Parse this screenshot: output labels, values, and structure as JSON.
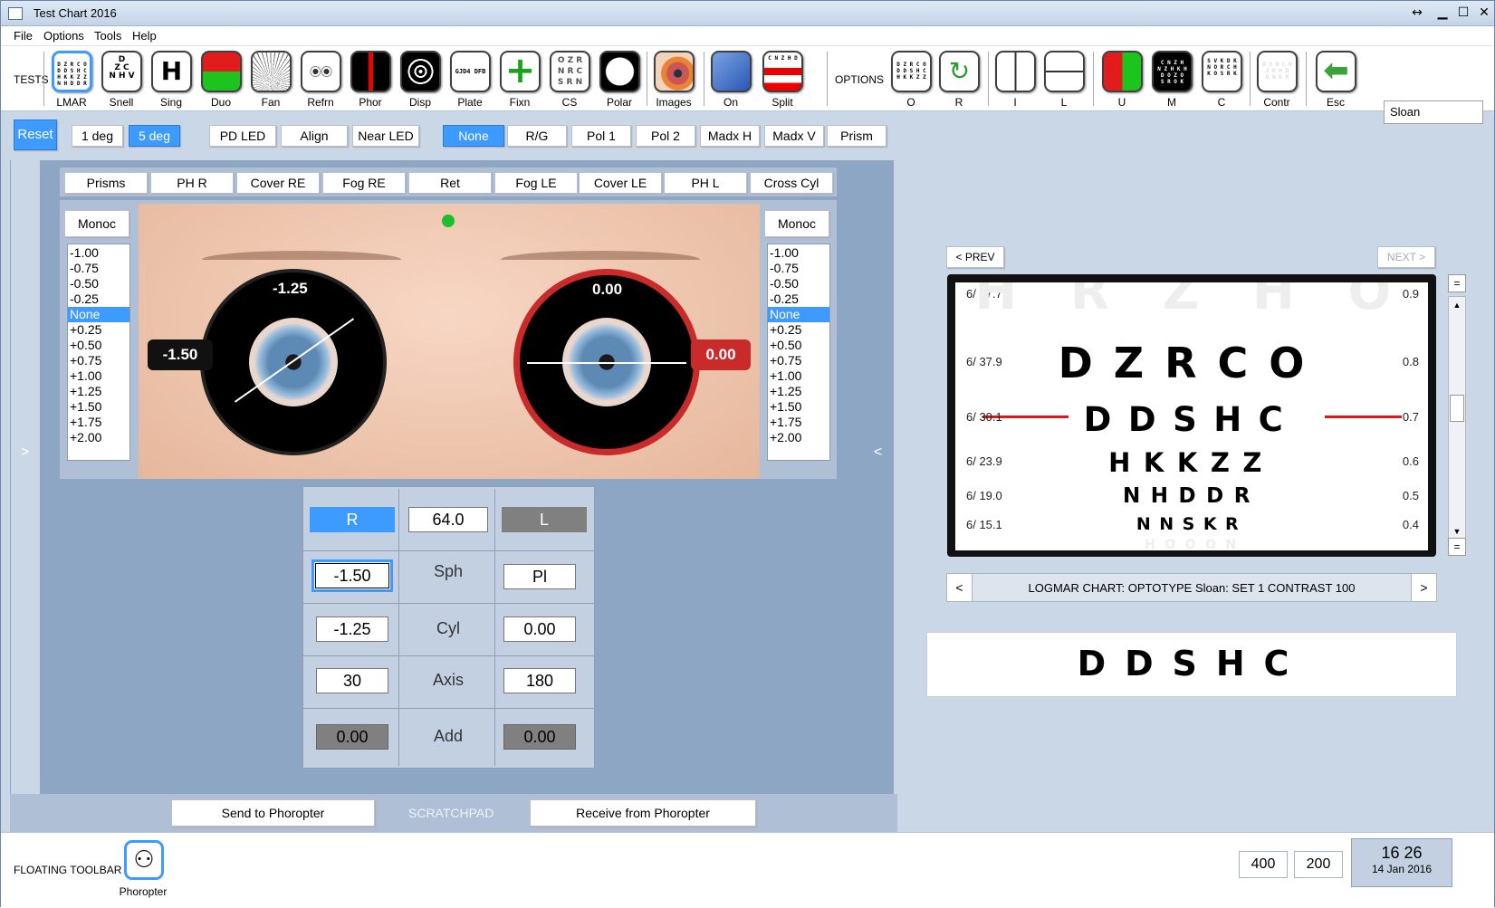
{
  "window": {
    "title": "Test Chart 2016",
    "restore": "↔",
    "minimize": "▁",
    "maximize": "☐",
    "close": "✕"
  },
  "menu": [
    "File",
    "Options",
    "Tools",
    "Help"
  ],
  "toolbar": {
    "tests_label": "TESTS",
    "options_label": "OPTIONS",
    "tests": [
      {
        "label": "LMAR",
        "icon": "logmar-chart-icon"
      },
      {
        "label": "Snell",
        "icon": "snellen-chart-icon"
      },
      {
        "label": "Sing",
        "icon": "single-letter-icon"
      },
      {
        "label": "Duo",
        "icon": "duochrome-icon"
      },
      {
        "label": "Fan",
        "icon": "fan-chart-icon"
      },
      {
        "label": "Refrn",
        "icon": "refraction-icon"
      },
      {
        "label": "Phor",
        "icon": "phoria-icon"
      },
      {
        "label": "Disp",
        "icon": "disparity-icon"
      },
      {
        "label": "Plate",
        "icon": "plate-icon"
      },
      {
        "label": "Fixn",
        "icon": "fixation-cross-icon"
      },
      {
        "label": "CS",
        "icon": "contrast-sensitivity-icon"
      },
      {
        "label": "Polar",
        "icon": "polar-icon"
      },
      {
        "label": "Images",
        "icon": "eye-image-icon"
      },
      {
        "label": "On",
        "icon": "screen-on-icon"
      },
      {
        "label": "Split",
        "icon": "split-chart-icon"
      }
    ],
    "options": [
      {
        "label": "O",
        "icon": "optotype-chart-icon"
      },
      {
        "label": "R",
        "icon": "rotate-icon"
      },
      {
        "label": "I",
        "icon": "vertical-line-icon"
      },
      {
        "label": "L",
        "icon": "horizontal-line-icon"
      },
      {
        "label": "U",
        "icon": "red-green-chart-icon"
      },
      {
        "label": "M",
        "icon": "mirror-chart-icon"
      },
      {
        "label": "C",
        "icon": "crowded-chart-icon"
      },
      {
        "label": "Contr",
        "icon": "contrast-icon"
      },
      {
        "label": "Esc",
        "icon": "back-arrow-icon"
      }
    ],
    "optotype_value": "Sloan",
    "tool_text": {
      "snell": "D\nZ C\nN H V",
      "sing": "H",
      "plate": "GJD4 DFB",
      "cs": "O Z R\nN R C\nS R N",
      "split": "C N Z H D"
    }
  },
  "controls": {
    "reset": "Reset",
    "deg1": "1 deg",
    "deg5": "5 deg",
    "pd_led": "PD LED",
    "align": "Align",
    "near_led": "Near LED",
    "filters": [
      "None",
      "R/G",
      "Pol 1",
      "Pol 2",
      "Madx H",
      "Madx V",
      "Prism"
    ]
  },
  "phoropter": {
    "tabs": [
      "Prisms",
      "PH R",
      "Cover RE",
      "Fog RE",
      "Ret",
      "Fog LE",
      "Cover LE",
      "PH L",
      "Cross Cyl"
    ],
    "monoc_left": "Monoc",
    "monoc_right": "Monoc",
    "steps": [
      "-1.00",
      "-0.75",
      "-0.50",
      "-0.25",
      "None",
      "+0.25",
      "+0.50",
      "+0.75",
      "+1.00",
      "+1.25",
      "+1.50",
      "+1.75",
      "+2.00"
    ],
    "selected_step": "None",
    "right_ring_top": "-1.25",
    "right_tag": "-1.50",
    "left_ring_top": "0.00",
    "left_tag": "0.00",
    "left_arrow": ">",
    "right_arrow": "<"
  },
  "rx": {
    "r_label": "R",
    "l_label": "L",
    "pd": "64.0",
    "rows": [
      {
        "name": "Sph",
        "r": "-1.50",
        "l": "Pl"
      },
      {
        "name": "Cyl",
        "r": "-1.25",
        "l": "0.00"
      },
      {
        "name": "Axis",
        "r": "30",
        "l": "180"
      },
      {
        "name": "Add",
        "r": "0.00",
        "l": "0.00"
      }
    ]
  },
  "scratchpad": {
    "send": "Send to  Phoropter",
    "label": "SCRATCHPAD",
    "receive": "Receive from  Phoropter"
  },
  "chart": {
    "prev": "< PREV",
    "next": "NEXT >",
    "rows": [
      {
        "snellen": "6/ 47.7",
        "logmar": "0.9",
        "letters": "H R Z H O"
      },
      {
        "snellen": "6/ 37.9",
        "logmar": "0.8",
        "letters": "DZRCO"
      },
      {
        "snellen": "6/ 30.1",
        "logmar": "0.7",
        "letters": "DDSHC"
      },
      {
        "snellen": "6/ 23.9",
        "logmar": "0.6",
        "letters": "HKKZZ"
      },
      {
        "snellen": "6/ 19.0",
        "logmar": "0.5",
        "letters": "NHDDR"
      },
      {
        "snellen": "6/ 15.1",
        "logmar": "0.4",
        "letters": "NNSKR"
      }
    ],
    "faded_bottom": "H O O O N",
    "caption": "LOGMAR CHART:  OPTOTYPE Sloan:   SET 1  CONTRAST  100",
    "nav_prev": "<",
    "nav_next": ">",
    "preview": "DDSHC",
    "scroll_up": "▲",
    "scroll_down": "▼",
    "scroll_top": "=",
    "scroll_bottom": "="
  },
  "status": {
    "floating_label": "FLOATING TOOLBAR",
    "phoropter_label": "Phoropter",
    "w": "400",
    "h": "200",
    "time": "16 26",
    "date": "14 Jan 2016"
  },
  "colors": {
    "accent": "#3d9bff",
    "red_line": "#d31d1d"
  }
}
